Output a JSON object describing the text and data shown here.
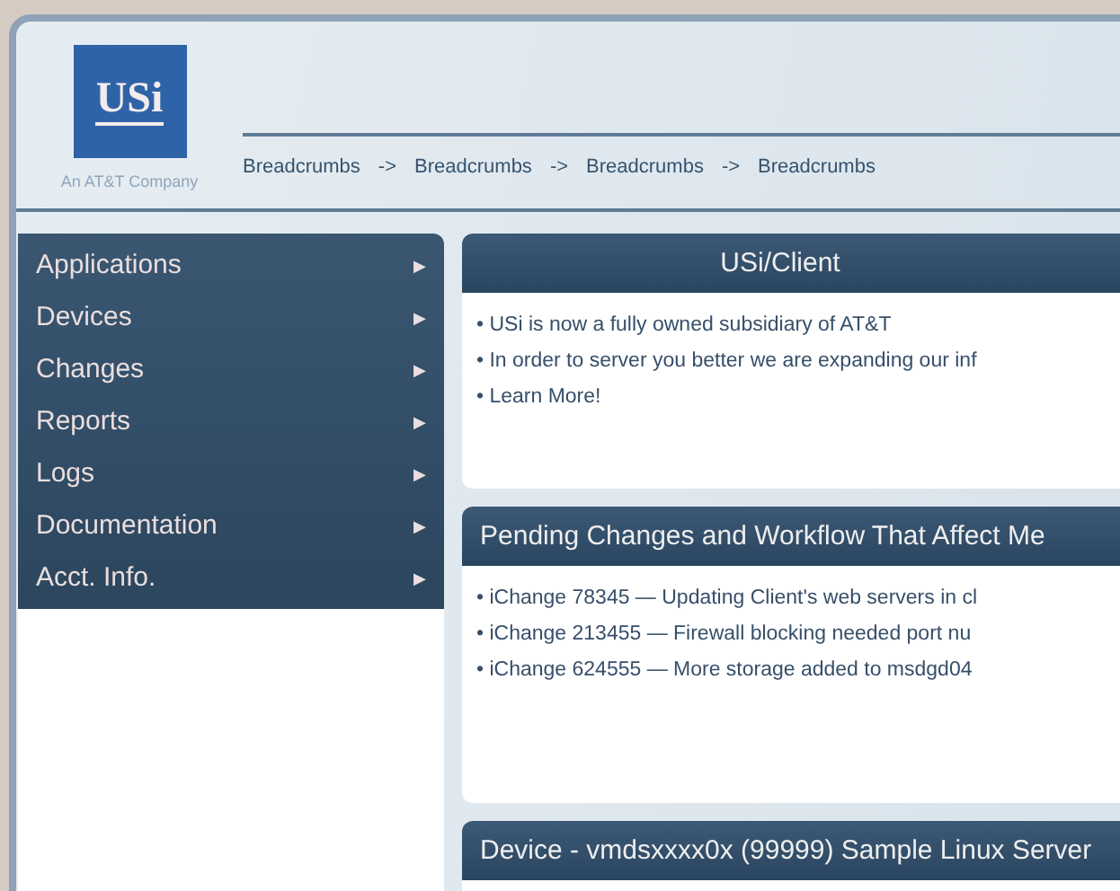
{
  "logo": {
    "text": "USi",
    "tagline": "An AT&T Company"
  },
  "breadcrumbs": {
    "items": [
      "Breadcrumbs",
      "Breadcrumbs",
      "Breadcrumbs",
      "Breadcrumbs"
    ],
    "separator": "->"
  },
  "menu": {
    "items": [
      {
        "label": "Applications",
        "arrow": "▶"
      },
      {
        "label": "Devices",
        "arrow": "▶"
      },
      {
        "label": "Changes",
        "arrow": "▶"
      },
      {
        "label": "Reports",
        "arrow": "▶"
      },
      {
        "label": "Logs",
        "arrow": "▶"
      },
      {
        "label": "Documentation",
        "arrow": "▶"
      },
      {
        "label": "Acct. Info.",
        "arrow": "▶"
      }
    ]
  },
  "panels": [
    {
      "title": "USi/Client",
      "centered": true,
      "items": [
        "• USi is now a fully owned subsidiary of AT&T",
        "• In order to server you better we are expanding our inf",
        "• Learn More!"
      ]
    },
    {
      "title": "Pending Changes and Workflow That Affect Me",
      "centered": false,
      "items": [
        "• iChange 78345 — Updating Client's web servers in cl",
        "• iChange 213455 — Firewall blocking needed port nu",
        "• iChange 624555 — More storage added to msdgd04"
      ]
    },
    {
      "title": "Device - vmdsxxxx0x (99999) Sample Linux Server",
      "centered": false
    }
  ]
}
